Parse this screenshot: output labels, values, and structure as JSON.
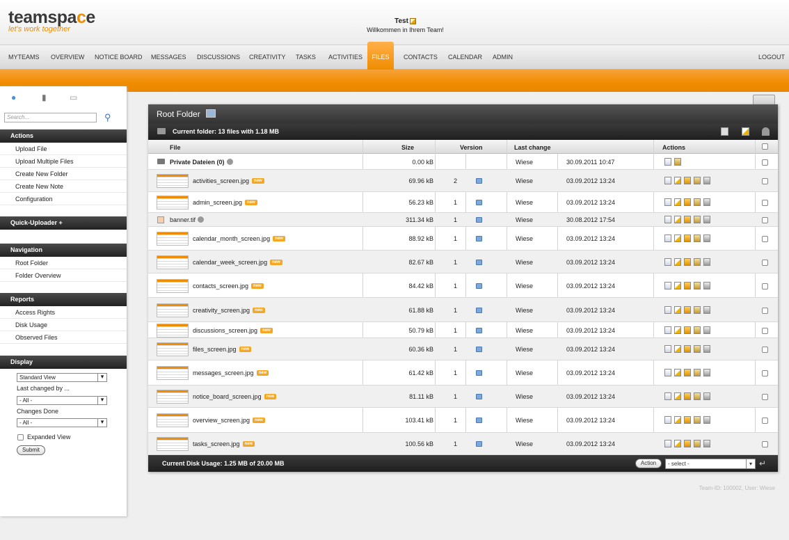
{
  "logo": {
    "text_before": "teamspa",
    "text_o": "c",
    "text_after": "e",
    "tagline": "let's work together"
  },
  "team": {
    "name": "Test",
    "welcome": "Willkommen in Ihrem Team!"
  },
  "nav": {
    "items": [
      {
        "label": "MYTEAMS"
      },
      {
        "label": "OVERVIEW"
      },
      {
        "label": "NOTICE BOARD"
      },
      {
        "label": "MESSAGES"
      },
      {
        "label": "DISCUSSIONS"
      },
      {
        "label": "CREATIVITY"
      },
      {
        "label": "TASKS"
      },
      {
        "label": "ACTIVITIES"
      },
      {
        "label": "FILES"
      },
      {
        "label": "CONTACTS"
      },
      {
        "label": "CALENDAR"
      },
      {
        "label": "ADMIN"
      }
    ],
    "active": "FILES",
    "logout": "LOGOUT"
  },
  "sidebar": {
    "search_placeholder": "Search...",
    "actions": {
      "title": "Actions",
      "links": [
        "Upload File",
        "Upload Multiple Files",
        "Create New Folder",
        "Create New Note",
        "Configuration"
      ]
    },
    "quick_uploader": "Quick-Uploader +",
    "navigation": {
      "title": "Navigation",
      "links": [
        "Root Folder",
        "Folder Overview"
      ]
    },
    "reports": {
      "title": "Reports",
      "links": [
        "Access Rights",
        "Disk Usage",
        "Observed Files"
      ]
    },
    "display": {
      "title": "Display",
      "view_select": "Standard View",
      "last_changed_label": "Last changed by ...",
      "last_changed_select": "- All -",
      "changes_label": "Changes Done",
      "changes_select": "- All -",
      "expanded_label": "Expanded View",
      "submit": "Submit"
    }
  },
  "panel": {
    "title": "Root Folder",
    "current_folder": "Current folder: 13 files with 1.18 MB",
    "columns": {
      "file": "File",
      "size": "Size",
      "version": "Version",
      "last_change": "Last change",
      "actions": "Actions"
    },
    "folder_row": {
      "name": "Private Dateien (0)",
      "size": "0.00 kB",
      "user": "Wiese",
      "date": "30.09.2011 10:47"
    },
    "badge_new": "new",
    "files": [
      {
        "name": "activities_screen.jpg",
        "size": "69.96 kB",
        "version": "2",
        "user": "Wiese",
        "date": "03.09.2012 13:24"
      },
      {
        "name": "admin_screen.jpg",
        "size": "56.23 kB",
        "version": "1",
        "user": "Wiese",
        "date": "03.09.2012 13:24"
      },
      {
        "name": "banner.tif",
        "size": "311.34 kB",
        "version": "1",
        "user": "Wiese",
        "date": "30.08.2012 17:54"
      },
      {
        "name": "calendar_month_screen.jpg",
        "size": "88.92 kB",
        "version": "1",
        "user": "Wiese",
        "date": "03.09.2012 13:24"
      },
      {
        "name": "calendar_week_screen.jpg",
        "size": "82.67 kB",
        "version": "1",
        "user": "Wiese",
        "date": "03.09.2012 13:24"
      },
      {
        "name": "contacts_screen.jpg",
        "size": "84.42 kB",
        "version": "1",
        "user": "Wiese",
        "date": "03.09.2012 13:24"
      },
      {
        "name": "creativity_screen.jpg",
        "size": "61.88 kB",
        "version": "1",
        "user": "Wiese",
        "date": "03.09.2012 13:24"
      },
      {
        "name": "discussions_screen.jpg",
        "size": "50.79 kB",
        "version": "1",
        "user": "Wiese",
        "date": "03.09.2012 13:24"
      },
      {
        "name": "files_screen.jpg",
        "size": "60.36 kB",
        "version": "1",
        "user": "Wiese",
        "date": "03.09.2012 13:24"
      },
      {
        "name": "messages_screen.jpg",
        "size": "61.42 kB",
        "version": "1",
        "user": "Wiese",
        "date": "03.09.2012 13:24"
      },
      {
        "name": "notice_board_screen.jpg",
        "size": "81.11 kB",
        "version": "1",
        "user": "Wiese",
        "date": "03.09.2012 13:24"
      },
      {
        "name": "overview_screen.jpg",
        "size": "103.41 kB",
        "version": "1",
        "user": "Wiese",
        "date": "03.09.2012 13:24"
      },
      {
        "name": "tasks_screen.jpg",
        "size": "100.56 kB",
        "version": "1",
        "user": "Wiese",
        "date": "03.09.2012 13:24"
      }
    ],
    "disk_usage": "Current Disk Usage: 1.25 MB of 20.00 MB",
    "action_button": "Action",
    "action_select": "- select -"
  },
  "footer": {
    "team_id": "Team-ID: 100002, User: Wiese"
  },
  "colors": {
    "accent": "#f08c00",
    "dark_bar": "#2b2b2b"
  }
}
